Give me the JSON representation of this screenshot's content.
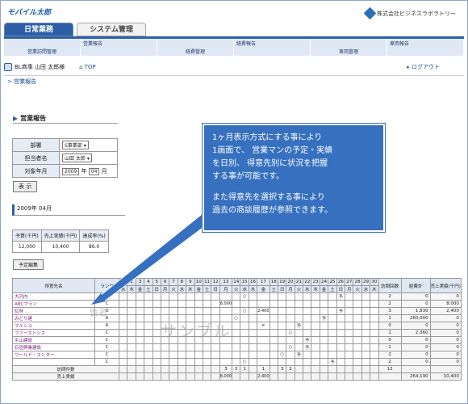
{
  "app": {
    "logo": "モバイル太郎",
    "company": "株式会社ビジネスラボラトリー"
  },
  "tabs": [
    {
      "label": "日常業務",
      "active": true
    },
    {
      "label": "システム管理",
      "active": false
    }
  ],
  "subnav": [
    {
      "upper": "",
      "lower": "営業訪問管理"
    },
    {
      "upper": "営業報告",
      "lower": ""
    },
    {
      "upper": "",
      "lower": "経費管理"
    },
    {
      "upper": "経費報告",
      "lower": ""
    },
    {
      "upper": "",
      "lower": "車両管理"
    },
    {
      "upper": "車両報告",
      "lower": ""
    }
  ],
  "user": {
    "name": "BL商事 山田 太郎様",
    "home": "TOP",
    "logout": "ログアウト"
  },
  "breadcrumb": "> 営業報告",
  "panel_title": "営業報告",
  "form": {
    "dept_label": "部署",
    "dept_value": "S事業部",
    "owner_label": "担当者名",
    "owner_value": "山田 太郎",
    "month_label": "対象年月",
    "year_value": "2009",
    "year_unit": "年",
    "month_value": "04",
    "month_unit": "月"
  },
  "show_button": "表 示",
  "month_heading": "2009年 04月",
  "summary": {
    "headers": [
      "予算(千円)",
      "売上実績(千円)",
      "達成率(%)"
    ],
    "values": [
      "12,000",
      "10,400",
      "86.0"
    ]
  },
  "plan_button": "予定編集",
  "callout": {
    "line1": "1ヶ月表示方式にする事により",
    "line2": "1画面で、 営業マンの予定・実績",
    "line3": "を日別、 得意先別に状況を把握",
    "line4": "する事が可能です。",
    "line5": "また得意先を選択する事により",
    "line6": "過去の商談履歴が参照できます。"
  },
  "grid": {
    "h_customer": "得意先名",
    "h_rank": "ランク",
    "h_visits": "訪問回数",
    "h_expense": "経費計",
    "h_sales": "売上実績(千円)",
    "days": [
      "1",
      "2",
      "3",
      "4",
      "5",
      "6",
      "7",
      "8",
      "9",
      "10",
      "11",
      "12",
      "13",
      "14",
      "15",
      "16",
      "17",
      "18",
      "19",
      "20",
      "21",
      "22",
      "23",
      "24",
      "25",
      "26",
      "27",
      "28",
      "29",
      "30"
    ],
    "weekdays": [
      "水",
      "木",
      "金",
      "土",
      "日",
      "月",
      "火",
      "水",
      "木",
      "金",
      "土",
      "日",
      "月",
      "火",
      "水",
      "木",
      "金",
      "土",
      "日",
      "月",
      "火",
      "水",
      "木",
      "金",
      "土",
      "日",
      "月",
      "火",
      "水",
      "木"
    ],
    "rows": [
      {
        "name": "大河内",
        "rank": "B",
        "cells": {
          "15": "○",
          "17": "",
          "26": "予"
        },
        "visits": "2",
        "expense": "0",
        "sales": "0"
      },
      {
        "name": "ABCプラン",
        "rank": "C",
        "cells": {
          "13": "8,000"
        },
        "visits": "2",
        "expense": "0",
        "sales": "8,000"
      },
      {
        "name": "紅林",
        "rank": "D",
        "cells": {
          "15": "○",
          "17": "2,400",
          "26": "予"
        },
        "visits": "3",
        "expense": "1,830",
        "sales": "2,400"
      },
      {
        "name": "みどり建",
        "rank": "A",
        "cells": {
          "14": "○",
          "24": "予"
        },
        "visits": "1",
        "expense": "260,000",
        "sales": "0"
      },
      {
        "name": "マルショ",
        "rank": "A",
        "cells": {
          "17": "×",
          "21": "予"
        },
        "visits": "0",
        "expense": "0",
        "sales": "0"
      },
      {
        "name": "ファーストシス",
        "rank": "C",
        "cells": {
          "20": "○"
        },
        "visits": "1",
        "expense": "2,360",
        "sales": "0"
      },
      {
        "name": "平山建設",
        "rank": "C",
        "cells": {
          "22": "予"
        },
        "visits": "0",
        "expense": "0",
        "sales": "0"
      },
      {
        "name": "石垣興業建設",
        "rank": "C",
        "cells": {
          "20": "○",
          "22": "予"
        },
        "visits": "1",
        "expense": "0",
        "sales": "0"
      },
      {
        "name": "ワールド・エンター",
        "rank": "C",
        "cells": {
          "19": "○",
          "21": "予"
        },
        "visits": "2",
        "expense": "0",
        "sales": "0"
      },
      {
        "name": "",
        "rank": "C",
        "cells": {
          "15": "○",
          "25": "予"
        },
        "visits": "2",
        "expense": "0",
        "sales": "0"
      }
    ],
    "footer_visits_label": "訪問件数",
    "footer_visits": {
      "13": "3",
      "14": "2",
      "15": "1",
      "17": "1",
      "19": "3",
      "20": "2"
    },
    "footer_visits_total": "12",
    "footer_sales_label": "売上実績",
    "footer_sales": {
      "13": "8,000",
      "17": "2,400"
    },
    "footer_expense_total": "264,190",
    "footer_sales_total": "10,400"
  },
  "watermarks": {
    "kana": "仮名",
    "sample": "サンプル"
  }
}
